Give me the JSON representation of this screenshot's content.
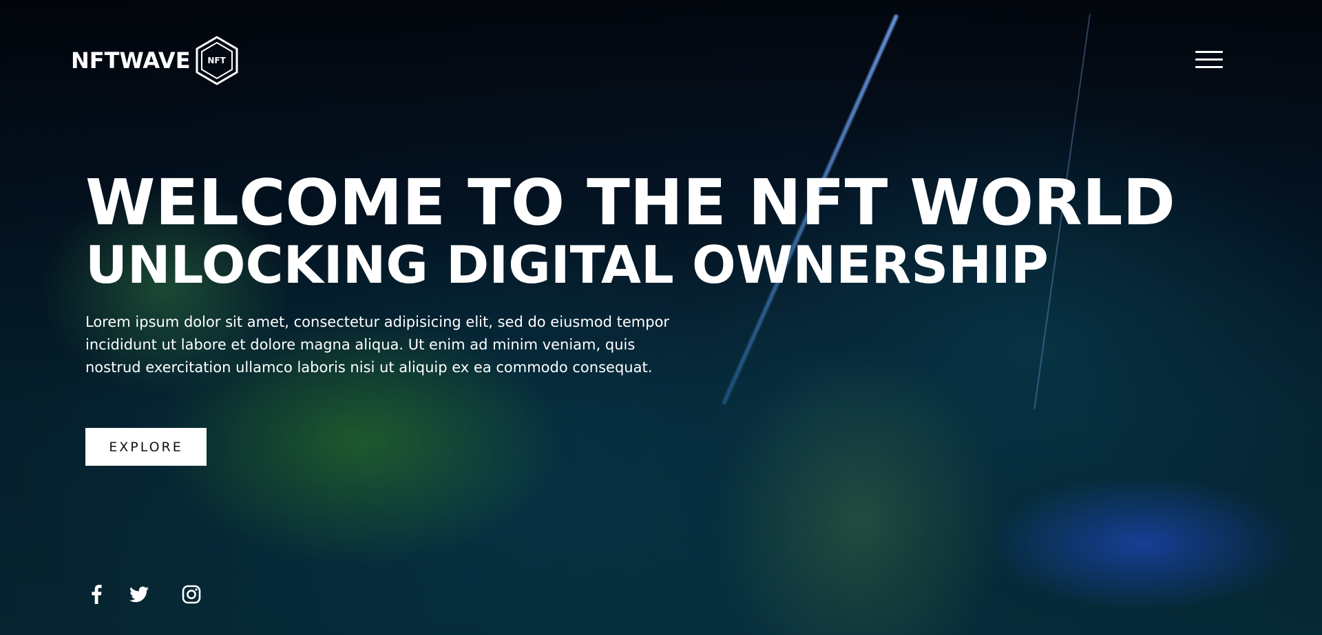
{
  "brand": {
    "name": "NFTWAVE",
    "badge": "NFT"
  },
  "hero": {
    "title": "WELCOME TO THE NFT WORLD",
    "subtitle": "UNLOCKING DIGITAL OWNERSHIP",
    "description": "Lorem ipsum dolor sit amet, consectetur adipisicing elit, sed do eiusmod tempor incididunt ut labore et dolore magna aliqua. Ut enim ad minim veniam, quis nostrud exercitation ullamco laboris nisi ut aliquip ex ea commodo consequat.",
    "cta_label": "EXPLORE"
  },
  "nav": {
    "menu_icon": "hamburger-menu-icon"
  },
  "socials": [
    {
      "icon": "facebook-icon"
    },
    {
      "icon": "twitter-icon"
    },
    {
      "icon": "instagram-icon"
    }
  ],
  "colors": {
    "text": "#ffffff",
    "button_bg": "#ffffff",
    "button_text": "#111111",
    "background": "#041425"
  }
}
